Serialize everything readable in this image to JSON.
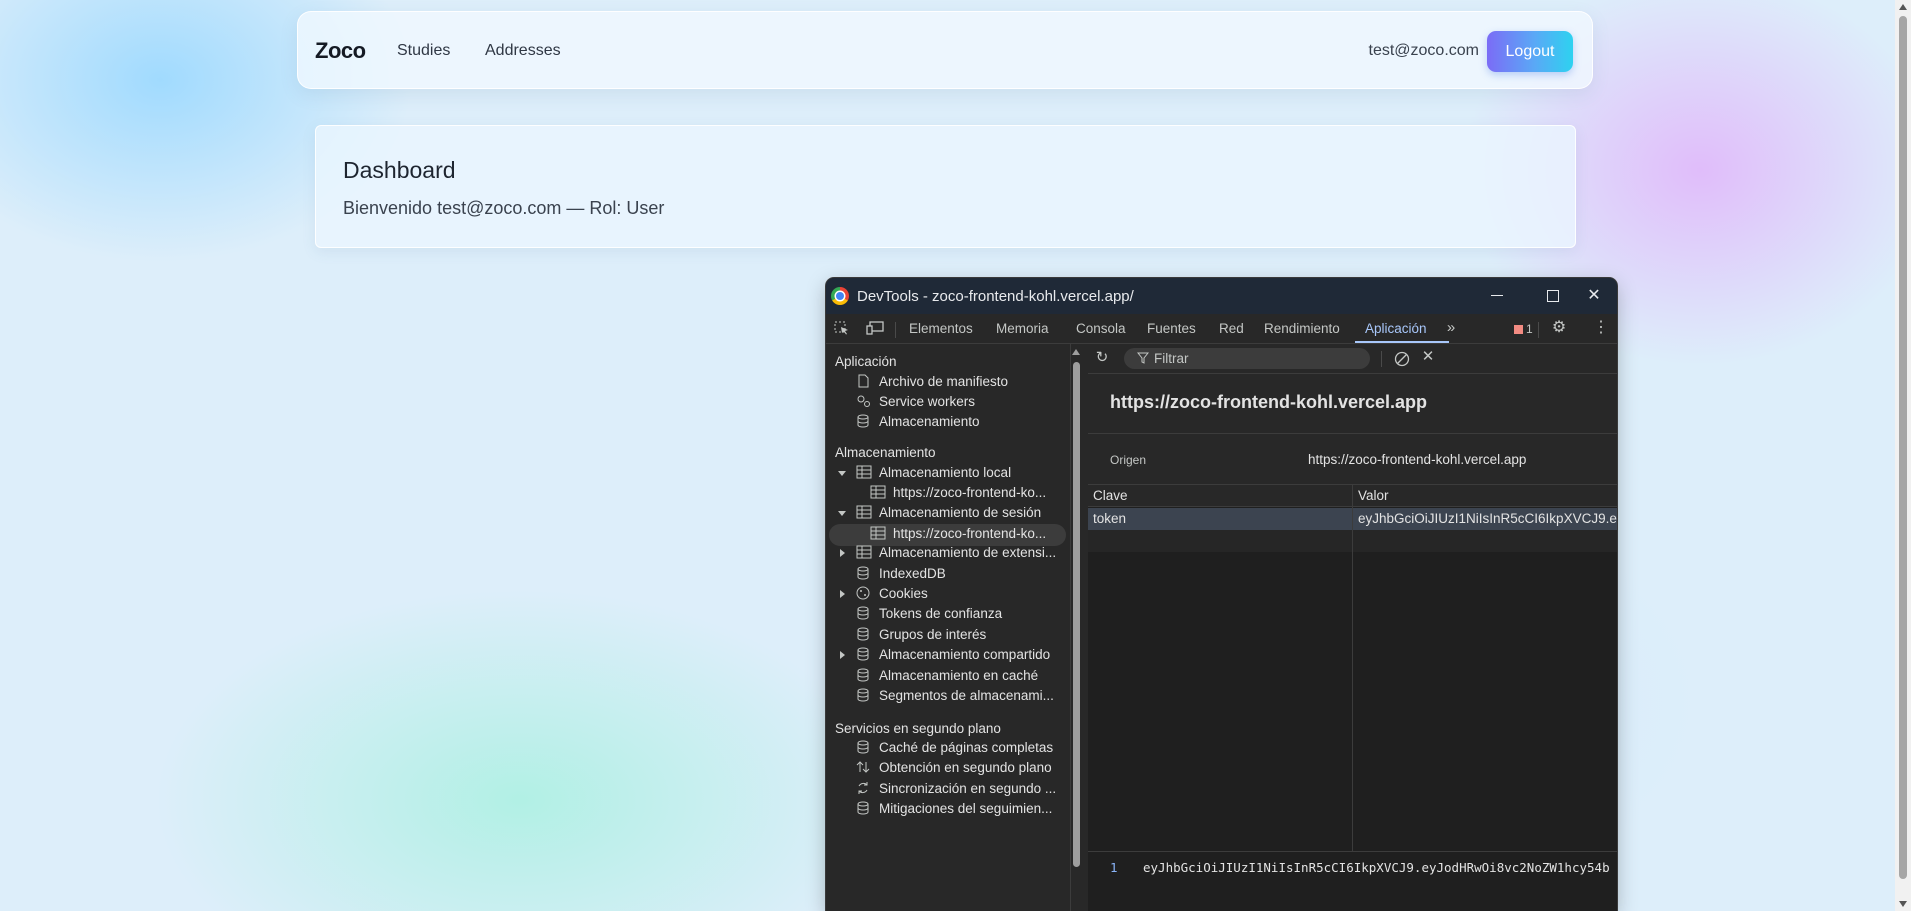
{
  "navbar": {
    "brand": "Zoco",
    "links": [
      "Studies",
      "Addresses"
    ],
    "user_email": "test@zoco.com",
    "logout_label": "Logout"
  },
  "dashboard": {
    "title": "Dashboard",
    "welcome": "Bienvenido test@zoco.com — Rol: User"
  },
  "devtools": {
    "window_title": "DevTools - zoco-frontend-kohl.vercel.app/",
    "tabs": [
      "Elementos",
      "Memoria",
      "Consola",
      "Fuentes",
      "Red",
      "Rendimiento",
      "Aplicación"
    ],
    "active_tab": "Aplicación",
    "issues_count": "1",
    "sidebar": {
      "section_app": "Aplicación",
      "app_items": [
        "Archivo de manifiesto",
        "Service workers",
        "Almacenamiento"
      ],
      "section_storage": "Almacenamiento",
      "storage_items": [
        "Almacenamiento local",
        "https://zoco-frontend-ko...",
        "Almacenamiento de sesión",
        "https://zoco-frontend-ko...",
        "Almacenamiento de extensi...",
        "IndexedDB",
        "Cookies",
        "Tokens de confianza",
        "Grupos de interés",
        "Almacenamiento compartido",
        "Almacenamiento en caché",
        "Segmentos de almacenami..."
      ],
      "section_bg": "Servicios en segundo plano",
      "bg_items": [
        "Caché de páginas completas",
        "Obtención en segundo plano",
        "Sincronización en segundo ...",
        "Mitigaciones del seguimien..."
      ]
    },
    "filter_placeholder": "Filtrar",
    "origin_title": "https://zoco-frontend-kohl.vercel.app",
    "origin_label": "Origen",
    "origin_value": "https://zoco-frontend-kohl.vercel.app",
    "table": {
      "headers": [
        "Clave",
        "Valor"
      ],
      "rows": [
        {
          "key": "token",
          "value": "eyJhbGciOiJIUzI1NiIsInR5cCI6IkpXVCJ9.e..."
        }
      ]
    },
    "preview_line_no": "1",
    "preview_value": "eyJhbGciOiJIUzI1NiIsInR5cCI6IkpXVCJ9.eyJodHRwOi8vc2NoZW1hcy54b"
  }
}
